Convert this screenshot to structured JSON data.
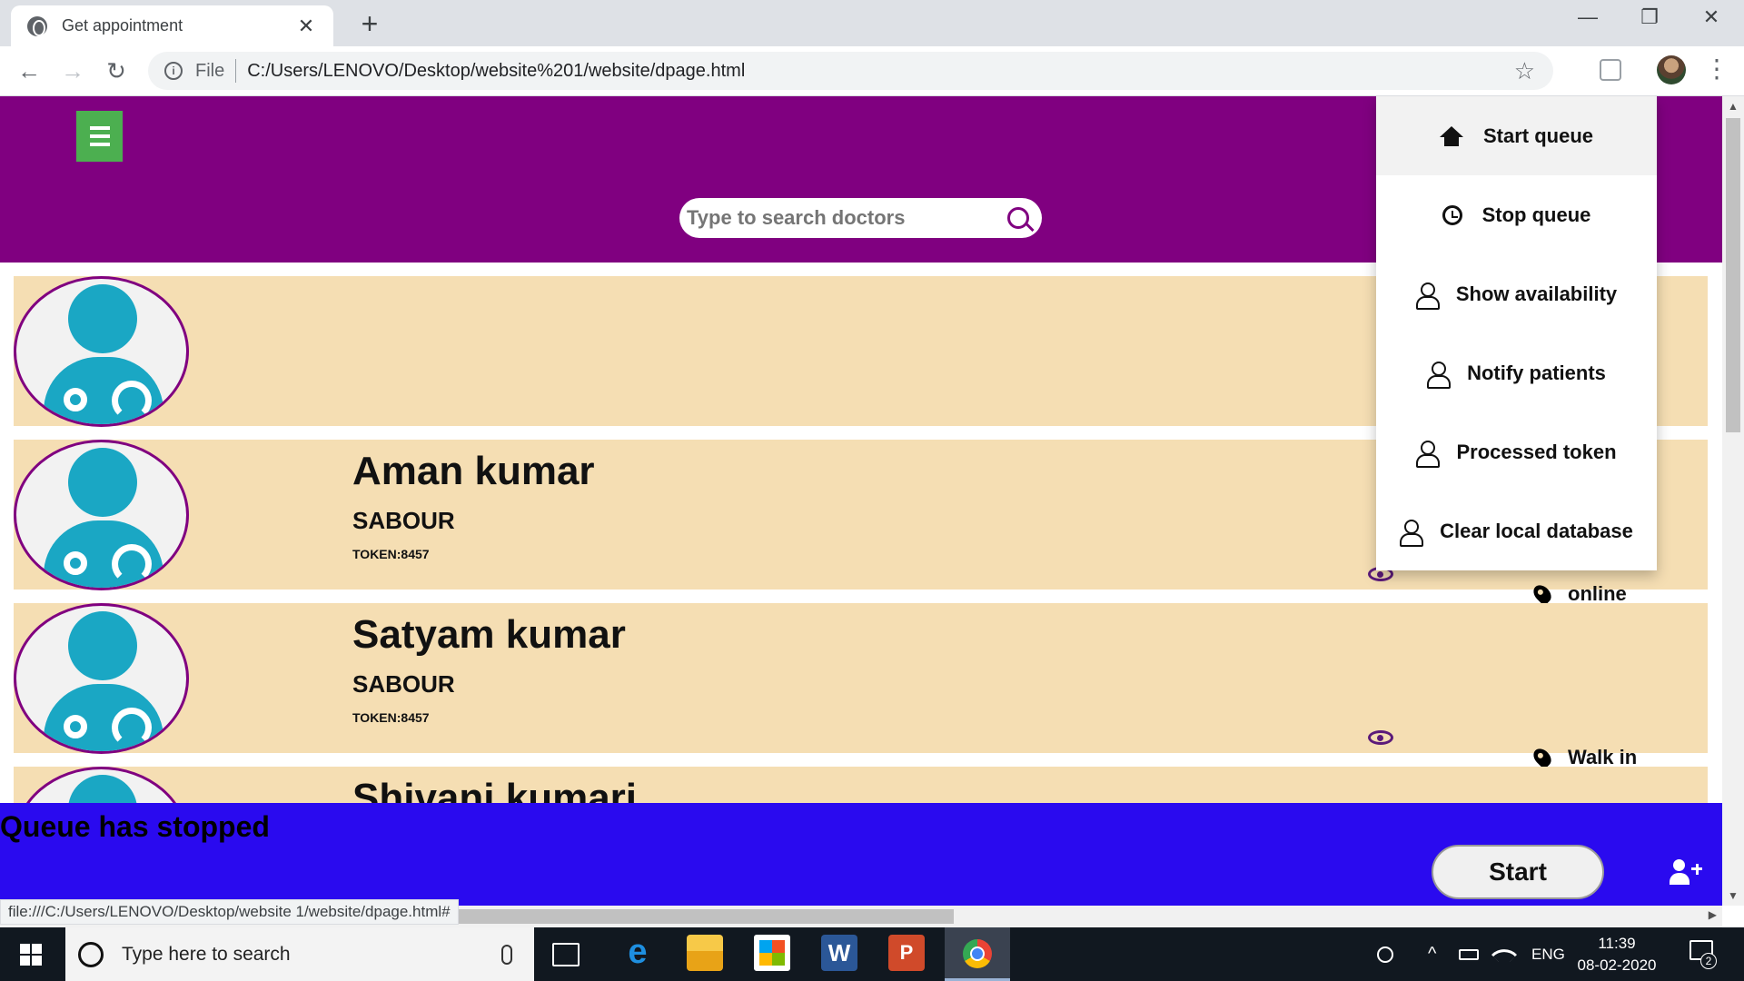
{
  "browser": {
    "tab_title": "Get appointment",
    "tab_close": "✕",
    "new_tab": "+",
    "window_controls": {
      "minimize": "—",
      "restore": "❐",
      "close": "✕"
    },
    "nav": {
      "back": "←",
      "forward": "→",
      "reload": "↻"
    },
    "address": {
      "info": "i",
      "scheme_label": "File",
      "url": "C:/Users/LENOVO/Desktop/website%201/website/dpage.html"
    },
    "bookmark_star": "☆",
    "menu": "⋮"
  },
  "page": {
    "search": {
      "placeholder": "Type to search doctors"
    },
    "doctors": [
      {
        "name": "",
        "place": "",
        "token": "",
        "location": ""
      },
      {
        "name": "Aman kumar",
        "place": "SABOUR",
        "token": "TOKEN:8457",
        "location": "online"
      },
      {
        "name": "Satyam kumar",
        "place": "SABOUR",
        "token": "TOKEN:8457",
        "location": "Walk in"
      },
      {
        "name": "Shivani kumari",
        "place": "",
        "token": "",
        "location": ""
      }
    ],
    "menu_items": [
      {
        "label": "Start queue",
        "icon": "home-icon"
      },
      {
        "label": "Stop queue",
        "icon": "history-icon"
      },
      {
        "label": "Show availability",
        "icon": "user-icon"
      },
      {
        "label": "Notify patients",
        "icon": "user-icon"
      },
      {
        "label": "Processed token",
        "icon": "user-icon"
      },
      {
        "label": "Clear local database",
        "icon": "user-icon"
      }
    ],
    "queue_status": "Queue has stopped",
    "start_button": "Start",
    "colors": {
      "header": "#800080",
      "card": "#f5deb3",
      "queue_bar": "#2a0aef",
      "menu_button": "#4caf50",
      "avatar": "#1aa7c4"
    }
  },
  "status_bar": {
    "url": "file:///C:/Users/LENOVO/Desktop/website 1/website/dpage.html#"
  },
  "taskbar": {
    "search_placeholder": "Type here to search",
    "language": "ENG",
    "time": "11:39",
    "date": "08-02-2020",
    "notification_count": "2",
    "tray_chevron": "^"
  }
}
